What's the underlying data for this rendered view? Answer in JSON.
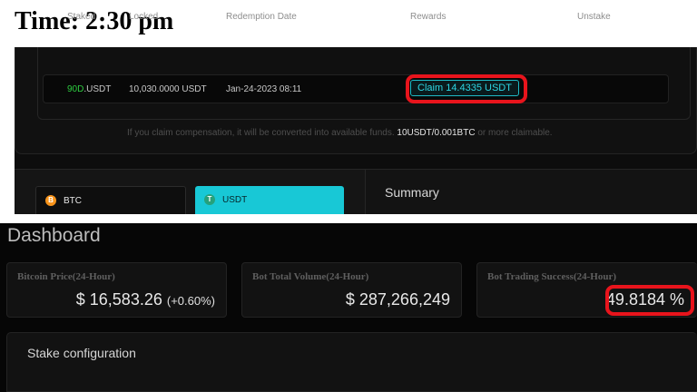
{
  "title": "Time: 2:30 pm",
  "stake_table": {
    "headers": {
      "staked": "Staked",
      "locked": "Locked",
      "redemption_date": "Redemption Date",
      "rewards": "Rewards",
      "unstake": "Unstake"
    },
    "row": {
      "staked_period": "90D",
      "staked_coin": ".USDT",
      "locked": "10,030.0000 USDT",
      "redemption_date": "Jan-24-2023 08:11",
      "claim_label": "Claim 14.4335 USDT"
    }
  },
  "notice": {
    "prefix": "If you claim compensation, it will be converted into available funds.",
    "highlight": "10USDT/0.001BTC",
    "suffix": "or more claimable."
  },
  "coins": [
    {
      "symbol": "B",
      "label": "BTC",
      "color": "#f7931a"
    },
    {
      "symbol": "T",
      "label": "USDT",
      "color": "#26a17b"
    }
  ],
  "summary_title": "Summary",
  "dashboard": {
    "title": "Dashboard",
    "stats": [
      {
        "label": "Bitcoin Price(24-Hour)",
        "value": "$ 16,583.26",
        "change": "(+0.60%)"
      },
      {
        "label": "Bot Total Volume(24-Hour)",
        "value": "$ 287,266,249"
      },
      {
        "label": "Bot Trading Success(24-Hour)",
        "value": "49.8184 %"
      }
    ],
    "config_title": "Stake configuration"
  },
  "colors": {
    "accent_cyan": "#18c8d6",
    "highlight_red": "#e8141c",
    "period_green": "#2ecc40"
  }
}
